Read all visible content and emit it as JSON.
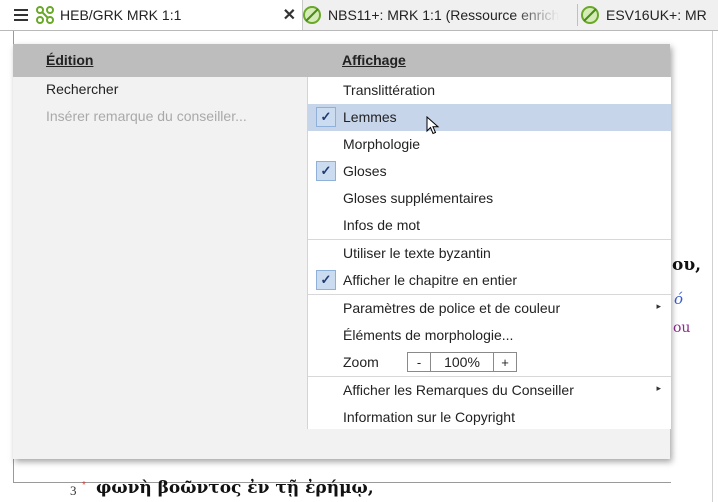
{
  "tabs": [
    {
      "label": "HEB/GRK MRK 1:1",
      "icon": "grid-link-icon",
      "active": true
    },
    {
      "label": "NBS11+: MRK 1:1 (Ressource enrich",
      "icon": "green-check-circle-icon"
    },
    {
      "label": "ESV16UK+: MR",
      "icon": "green-check-circle-icon"
    }
  ],
  "colors": {
    "accent_green": "#8cc63f",
    "highlight": "#c6d5ea",
    "header": "#bdbdbd"
  },
  "menu": {
    "edition_header": "Édition",
    "affichage_header": "Affichage",
    "left_items": [
      {
        "label": "Rechercher",
        "enabled": true
      },
      {
        "label": "Insérer remarque du conseiller...",
        "enabled": false
      }
    ],
    "right_items": [
      {
        "label": "Translittération",
        "checked": false
      },
      {
        "label": "Lemmes",
        "checked": true
      },
      {
        "label": "Morphologie",
        "checked": false
      },
      {
        "label": "Gloses",
        "checked": true
      },
      {
        "label": "Gloses supplémentaires",
        "checked": false
      },
      {
        "label": "Infos de mot",
        "checked": false
      },
      {
        "label": "Utiliser le texte byzantin",
        "checked": false
      },
      {
        "label": "Afficher le chapitre en entier",
        "checked": true
      },
      {
        "label": "Paramètres de police et de couleur",
        "submenu": true
      },
      {
        "label": "Éléments de morphologie...",
        "submenu": false
      },
      {
        "label": "Afficher les Remarques du Conseiller",
        "submenu": true
      },
      {
        "label": "Information sur le Copyright",
        "submenu": false
      }
    ],
    "zoom": {
      "label": "Zoom",
      "minus": "-",
      "value": "100%",
      "plus": "+"
    },
    "check_glyph": "✓",
    "submenu_glyph": "▸"
  },
  "document": {
    "fragment_right": "ου,",
    "fragment_blue": "ό",
    "fragment_purple": "ou",
    "verse_number": "3",
    "verse_text": "φωνὴ βοῶντος ἐν τῇ ἐρήμῳ,"
  }
}
